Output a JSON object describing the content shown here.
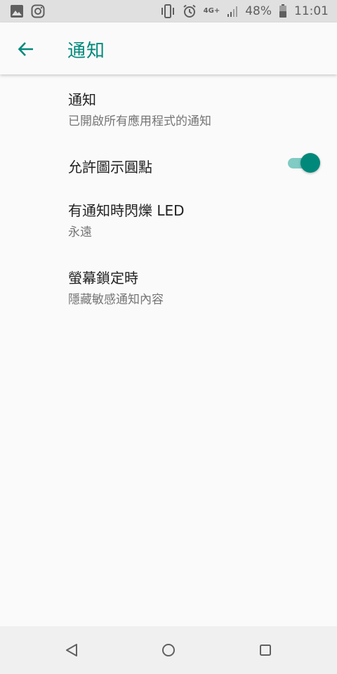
{
  "status_bar": {
    "network_label": "4G+",
    "battery_percent": "48%",
    "time": "11:01",
    "icons": [
      "image-icon",
      "instagram-icon",
      "vibrate-icon",
      "alarm-icon",
      "network-icon",
      "signal-icon",
      "battery-icon"
    ]
  },
  "app_bar": {
    "title": "通知",
    "back_icon": "arrow-left-icon",
    "accent_color": "#00897b"
  },
  "settings": {
    "items": [
      {
        "title": "通知",
        "subtitle": "已開啟所有應用程式的通知"
      },
      {
        "title": "允許圖示圓點",
        "toggle_on": true
      },
      {
        "title": "有通知時閃爍 LED",
        "subtitle": "永遠"
      },
      {
        "title": "螢幕鎖定時",
        "subtitle": "隱藏敏感通知內容"
      }
    ]
  },
  "nav_bar": {
    "icons": [
      "nav-back-icon",
      "nav-home-icon",
      "nav-recents-icon"
    ]
  }
}
